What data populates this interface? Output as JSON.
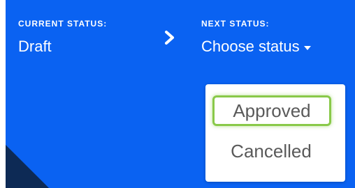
{
  "current_status": {
    "label": "CURRENT STATUS:",
    "value": "Draft"
  },
  "next_status": {
    "label": "NEXT STATUS:",
    "placeholder": "Choose status",
    "options": [
      "Approved",
      "Cancelled"
    ],
    "highlighted_option": "Approved"
  },
  "icons": {
    "transition_arrow": "chevron-right-icon",
    "dropdown_caret": "caret-down-icon"
  },
  "colors": {
    "panel_background": "#0a62f2",
    "highlight_outline": "#89c949",
    "option_text": "#5a5a5a",
    "corner_shape": "#0d2a55"
  }
}
